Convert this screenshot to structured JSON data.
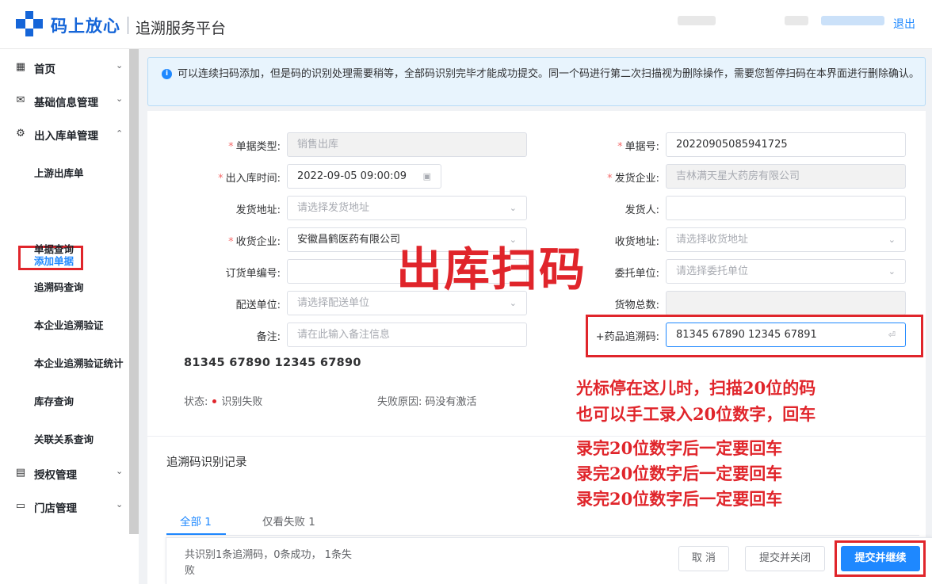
{
  "header": {
    "brand": "码上放心",
    "platform": "追溯服务平台",
    "logout": "退出",
    "brand_color": "#1565d8"
  },
  "sidebar": {
    "items": [
      {
        "label": "首页",
        "icon": "grid-icon"
      },
      {
        "label": "基础信息管理",
        "icon": "mail-icon"
      },
      {
        "label": "出入库单管理",
        "icon": "gear-icon"
      },
      {
        "label": "授权管理",
        "icon": "document-icon"
      },
      {
        "label": "门店管理",
        "icon": "folder-icon"
      }
    ],
    "sub_items": [
      "上游出库单",
      "添加单据",
      "单据查询",
      "追溯码查询",
      "本企业追溯验证",
      "本企业追溯验证统计",
      "库存查询",
      "关联关系查询"
    ],
    "active_sub": "添加单据"
  },
  "alert": {
    "text": "可以连续扫码添加，但是码的识别处理需要稍等，全部码识别完毕才能成功提交。同一个码进行第二次扫描视为删除操作，需要您暂停扫码在本界面进行删除确认。"
  },
  "form": {
    "doc_type": {
      "label": "单据类型:",
      "value": "销售出库"
    },
    "doc_no": {
      "label": "单据号:",
      "value": "20220905085941725"
    },
    "io_time": {
      "label": "出入库时间:",
      "value": "2022-09-05 09:00:09"
    },
    "ship_company": {
      "label": "发货企业:",
      "value": "吉林满天星大药房有限公司"
    },
    "ship_address": {
      "label": "发货地址:",
      "placeholder": "请选择发货地址"
    },
    "shipper": {
      "label": "发货人:",
      "value": ""
    },
    "recv_company": {
      "label": "收货企业:",
      "value": "安徽昌鹤医药有限公司"
    },
    "recv_address": {
      "label": "收货地址:",
      "placeholder": "请选择收货地址"
    },
    "order_no": {
      "label": "订货单编号:",
      "value": ""
    },
    "entrust": {
      "label": "委托单位:",
      "placeholder": "请选择委托单位"
    },
    "delivery": {
      "label": "配送单位:",
      "placeholder": "请选择配送单位"
    },
    "total": {
      "label": "货物总数:",
      "value": ""
    },
    "remark": {
      "label": "备注:",
      "placeholder": "请在此输入备注信息"
    },
    "trace_code": {
      "label": "+药品追溯码:",
      "value": "81345 67890 12345 67891",
      "suffix": "⏎"
    }
  },
  "scan_result": {
    "code": "81345 67890 12345 67890",
    "status_label": "状态:",
    "status_value": "识别失败",
    "fail_label": "失败原因:",
    "fail_value": "码没有激活"
  },
  "records": {
    "title": "追溯码识别记录",
    "tabs": [
      "全部 1",
      "仅看失败 1"
    ]
  },
  "footer": {
    "summary": "共识别1条追溯码，0条成功， 1条失败",
    "cancel": "取 消",
    "submit_close": "提交并关闭",
    "submit_continue": "提交并继续"
  },
  "annotations": {
    "big": "出库扫码",
    "lines": [
      "光标停在这儿时，扫描20位的码",
      "也可以手工录入20位数字，回车",
      "录完20位数字后一定要回车",
      "录完20位数字后一定要回车",
      "录完20位数字后一定要回车"
    ],
    "color": "#e0252b"
  }
}
